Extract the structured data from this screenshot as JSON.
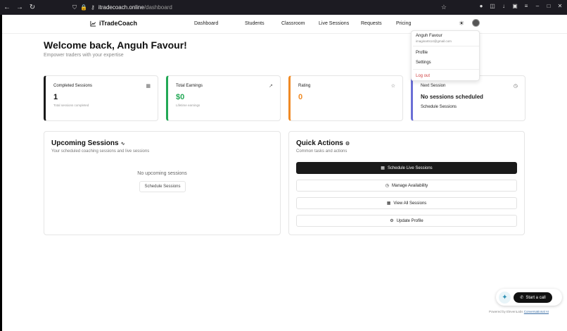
{
  "browser": {
    "url_host": "itradecoach.online",
    "url_path": "/dashboard"
  },
  "brand": {
    "name": "iTradeCoach"
  },
  "nav": [
    "Dashboard",
    "Students",
    "Classroom",
    "Live Sessions",
    "Requests",
    "Pricing"
  ],
  "welcome": {
    "title": "Welcome back, Anguh Favour!",
    "subtitle": "Empower traders with your expertise"
  },
  "stats": [
    {
      "label": "Completed Sessions",
      "value": "1",
      "note": "Total sessions completed",
      "accent": "#1a1a1a",
      "value_color": "#111111",
      "icon": "calendar-icon"
    },
    {
      "label": "Total Earnings",
      "value": "$0",
      "note": "Lifetime earnings",
      "accent": "#22a855",
      "value_color": "#22a855",
      "icon": "trend-up-icon"
    },
    {
      "label": "Rating",
      "value": "0",
      "accent": "#f08a24",
      "value_color": "#f08a24",
      "icon": "star-icon"
    },
    {
      "label": "Next Session",
      "status": "No sessions scheduled",
      "link": "Schedule Sessions",
      "accent": "#6b6fd6",
      "icon": "clock-icon"
    }
  ],
  "upcoming": {
    "title": "Upcoming Sessions",
    "subtitle": "Your scheduled coaching sessions and live sessions",
    "empty_text": "No upcoming sessions",
    "button": "Schedule Sessions"
  },
  "quick_actions": {
    "title": "Quick Actions",
    "subtitle": "Common tasks and actions",
    "buttons": [
      {
        "label": "Schedule Live Sessions",
        "icon": "calendar-icon"
      },
      {
        "label": "Manage Availability",
        "icon": "clock-icon"
      },
      {
        "label": "View All Sessions",
        "icon": "calendar-icon"
      },
      {
        "label": "Update Profile",
        "icon": "gear-icon"
      }
    ]
  },
  "user_menu": {
    "name": "Anguh Favour",
    "email": "imaginarts14@gmail.com",
    "items": [
      "Profile",
      "Settings"
    ],
    "logout": "Log out"
  },
  "chat_widget": {
    "call_label": "Start a call",
    "powered_prefix": "Powered by ElevenLabs",
    "powered_link": "Conversational AI"
  }
}
